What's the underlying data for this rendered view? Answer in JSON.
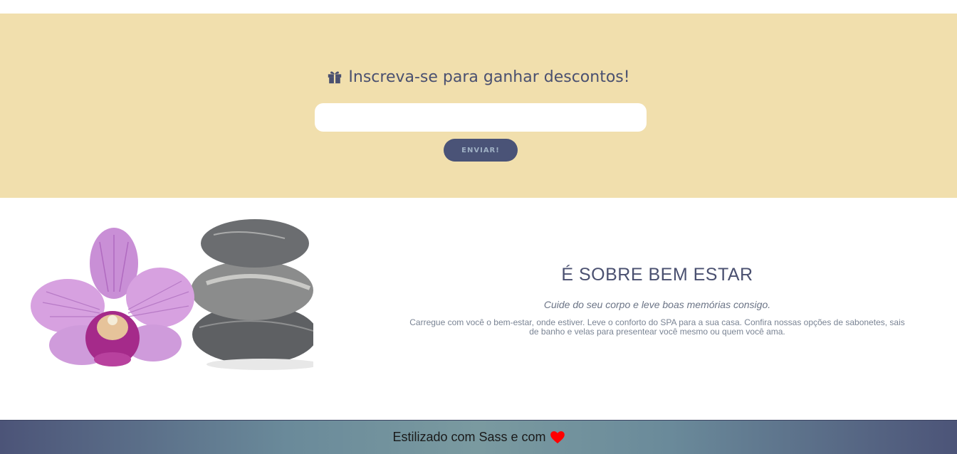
{
  "newsletter": {
    "title": "Inscreva-se para ganhar descontos!",
    "icon": "gift-icon",
    "email_placeholder": "",
    "button_label": "ENVIAR!",
    "background": "#f1dfad",
    "button_color": "#4a5377"
  },
  "about": {
    "title": "É SOBRE BEM ESTAR",
    "subtitle": "Cuide do seu corpo e leve boas memórias consigo.",
    "text": "Carregue com você o bem-estar, onde estiver. Leve o conforto do SPA para a sua casa. Confira nossas opções de sabonetes, sais de banho e velas para presentear você mesmo ou quem você ama.",
    "image": "orchid-and-stones-image"
  },
  "footer": {
    "text": "Estilizado com Sass e com",
    "icon": "heart-icon",
    "heart_color": "#ff0000"
  }
}
